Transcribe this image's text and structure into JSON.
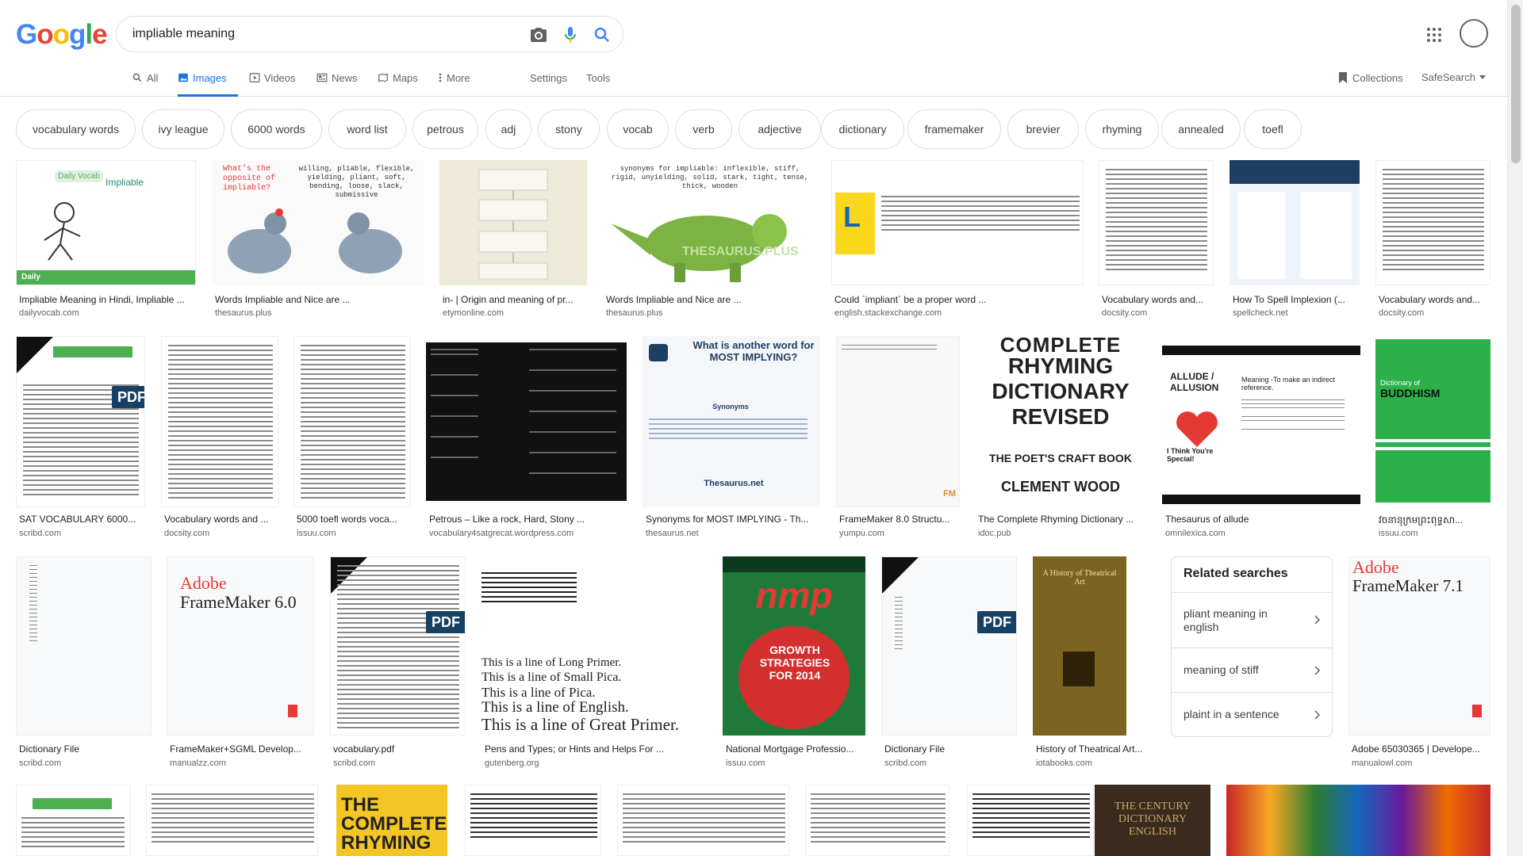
{
  "search": {
    "query": "impliable meaning"
  },
  "logo": {
    "letters": [
      "G",
      "o",
      "o",
      "g",
      "l",
      "e"
    ],
    "colors": [
      "#4285f4",
      "#ea4335",
      "#fbbc05",
      "#4285f4",
      "#34a853",
      "#ea4335"
    ]
  },
  "nav": {
    "all": "All",
    "images": "Images",
    "videos": "Videos",
    "news": "News",
    "maps": "Maps",
    "more": "More",
    "settings": "Settings",
    "tools": "Tools",
    "collections": "Collections",
    "safesearch": "SafeSearch"
  },
  "chips": [
    "vocabulary words",
    "ivy league",
    "6000 words",
    "word list",
    "petrous",
    "adj",
    "stony",
    "vocab",
    "verb",
    "adjective",
    "dictionary",
    "framemaker",
    "brevier",
    "rhyming",
    "annealed",
    "toefl"
  ],
  "row1": [
    {
      "caption": "Impliable Meaning in Hindi, Impliable ...",
      "source": "dailyvocab.com"
    },
    {
      "caption": "Words Impliable and Nice are ...",
      "source": "thesaurus.plus"
    },
    {
      "caption": "in- | Origin and meaning of pr...",
      "source": "etymonline.com"
    },
    {
      "caption": "Words Impliable and Nice are ...",
      "source": "thesaurus.plus"
    },
    {
      "caption": "Could `impliant` be a proper word ...",
      "source": "english.stackexchange.com"
    },
    {
      "caption": "Vocabulary words and...",
      "source": "docsity.com"
    },
    {
      "caption": "How To Spell Implexion (...",
      "source": "spellcheck.net"
    },
    {
      "caption": "Vocabulary words and...",
      "source": "docsity.com"
    }
  ],
  "row2": [
    {
      "caption": "SAT VOCABULARY 6000...",
      "source": "scribd.com"
    },
    {
      "caption": "Vocabulary words and ...",
      "source": "docsity.com"
    },
    {
      "caption": "5000 toefl words voca...",
      "source": "issuu.com"
    },
    {
      "caption": "Petrous – Like a rock, Hard, Stony ...",
      "source": "vocabulary4satgrecat.wordpress.com"
    },
    {
      "caption": "Synonyms for MOST IMPLYING - Th...",
      "source": "thesaurus.net"
    },
    {
      "caption": "FrameMaker 8.0 Structu...",
      "source": "yumpu.com"
    },
    {
      "caption": "The Complete Rhyming Dictionary ...",
      "source": "idoc.pub"
    },
    {
      "caption": "Thesaurus of allude",
      "source": "omnilexica.com"
    },
    {
      "caption": "វចនានុក្រមព្រះពុទ្ធសា...",
      "source": "issuu.com"
    }
  ],
  "row3": [
    {
      "caption": "Dictionary File",
      "source": "scribd.com"
    },
    {
      "caption": "FrameMaker+SGML Develop...",
      "source": "manualzz.com"
    },
    {
      "caption": "vocabulary.pdf",
      "source": "scribd.com"
    },
    {
      "caption": "Pens and Types; or Hints and Helps For ...",
      "source": "gutenberg.org"
    },
    {
      "caption": "National Mortgage Professio...",
      "source": "issuu.com"
    },
    {
      "caption": "Dictionary File",
      "source": "scribd.com"
    },
    {
      "caption": "History of Theatrical Art...",
      "source": "iotabooks.com"
    },
    {
      "caption": "Adobe 65030365 | Develope...",
      "source": "manualowl.com"
    }
  ],
  "related": {
    "title": "Related searches",
    "items": [
      "pliant meaning in english",
      "meaning of stiff",
      "plaint in a sentence"
    ]
  },
  "thumb_text": {
    "daily_vocab": "Daily Vocab",
    "impliable": "Impliable",
    "daily": "Daily",
    "opposite": "What's the opposite of impliable?",
    "synonyms_list": "willing, pliable, flexible, yielding, pliant, soft, bending, loose, slack, submissive",
    "antonyms_list": "synonyms for impliable: inflexible, stiff, rigid, unyielding, solid, stark, tight, tense, thick, wooden",
    "watermark": "THESAURUS.PLUS",
    "pdf": "PDF",
    "most_implying": "What is another word for MOST IMPLYING?",
    "synonyms": "Synonyms",
    "thesaurus_net": "Thesaurus.net",
    "rhyming_1": "COMPLETE",
    "rhyming_2": "RHYMING",
    "rhyming_3": "DICTIONARY",
    "rhyming_4": "REVISED",
    "rhyming_5": "THE POET'S CRAFT BOOK",
    "rhyming_6": "CLEMENT WOOD",
    "allude": "ALLUDE / ALLUSION",
    "allude_meaning": "Meaning -To make an indirect reference.",
    "think_special": "I Think You're Special!",
    "buddhism_1": "Dictionary of",
    "buddhism_2": "BUDDHISM",
    "adobe": "Adobe",
    "framemaker6": "FrameMaker 6.0",
    "framemaker71": "FrameMaker 7.1",
    "nmp": "nmp",
    "growth": "GROWTH STRATEGIES FOR 2014",
    "theatrical": "A History of Theatrical Art",
    "primer": "This is a line of Great Primer.",
    "english_line": "This is a line of English.",
    "pica": "This is a line of Pica.",
    "small_pica": "This is a line of Small Pica.",
    "long_primer": "This is a line of Long Primer.",
    "complete_rhyming_2": "THE COMPLETE RHYMING",
    "century": "THE CENTURY DICTIONARY ENGLISH"
  }
}
